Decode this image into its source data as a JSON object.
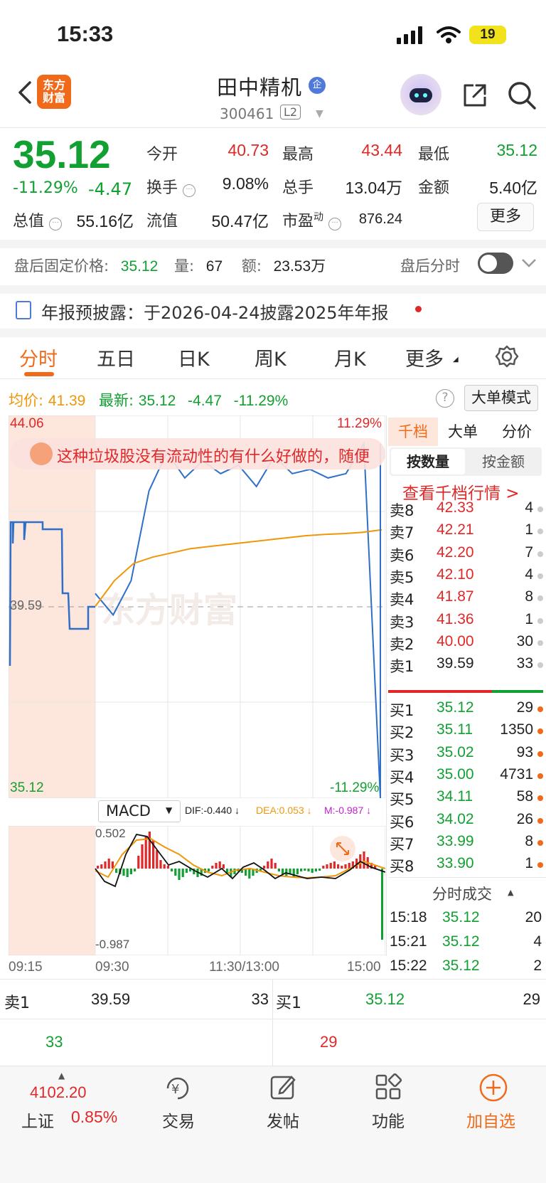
{
  "status_bar": {
    "time": "15:33",
    "battery": "19"
  },
  "header": {
    "logo_line1": "东方",
    "logo_line2": "财富",
    "stock_name": "田中精机",
    "badge": "企",
    "stock_code": "300461",
    "level": "L2"
  },
  "quote": {
    "price": "35.12",
    "change_pct": "-11.29%",
    "change_val": "-4.47",
    "open_label": "今开",
    "open": "40.73",
    "high_label": "最高",
    "high": "43.44",
    "low_label": "最低",
    "low": "35.12",
    "turnover_label": "换手",
    "turnover": "9.08%",
    "volume_label": "总手",
    "volume": "13.04万",
    "amount_label": "金额",
    "amount": "5.40亿",
    "mktcap_label": "总值",
    "mktcap": "55.16亿",
    "float_label": "流值",
    "float_cap": "50.47亿",
    "pe_label": "市盈",
    "pe_sup": "动",
    "pe": "876.24",
    "more_button": "更多"
  },
  "after_hours": {
    "price_label": "盘后固定价格:",
    "price": "35.12",
    "vol_label": "量:",
    "vol": "67",
    "amt_label": "额:",
    "amt": "23.53万",
    "chart_label": "盘后分时"
  },
  "announcement": {
    "text": "年报预披露：于2026-04-24披露2025年年报"
  },
  "tabs": [
    "分时",
    "五日",
    "日K",
    "周K",
    "月K",
    "更多"
  ],
  "chart_header": {
    "avg_label": "均价:",
    "avg": "41.39",
    "latest_label": "最新:",
    "latest": "35.12",
    "chg": "-4.47",
    "chg_pct": "-11.29%",
    "big_order_button": "大单模式"
  },
  "chart": {
    "y_top": "44.06",
    "y_mid": "39.59",
    "y_bottom": "35.12",
    "pct_top": "11.29%",
    "pct_bottom": "-11.29%",
    "watermark": "东方财富",
    "comment": "这种垃圾股没有流动性的有什么好做的，随便",
    "x_labels": [
      "09:15",
      "09:30",
      "11:30/13:00",
      "15:00"
    ]
  },
  "macd": {
    "selector": "MACD",
    "dif": "DIF:-0.440 ↓",
    "dea": "DEA:0.053 ↓",
    "m": "M:-0.987 ↓",
    "top": "0.502",
    "bottom": "-0.987"
  },
  "chart_data": {
    "type": "line",
    "title": "",
    "x_range": [
      "09:30",
      "15:00"
    ],
    "ylim": [
      35.12,
      44.06
    ],
    "reference": 39.59,
    "series": [
      {
        "values": [
          39.9,
          39.4,
          40.2,
          42.3,
          43.2,
          42.6,
          43.0,
          42.7,
          42.9,
          42.4,
          43.1,
          42.7,
          42.8,
          42.6,
          42.7,
          43.4,
          35.12
        ]
      },
      {
        "values": [
          39.6,
          40.2,
          40.6,
          40.75,
          40.85,
          40.95,
          41.0,
          41.05,
          41.1,
          41.15,
          41.2,
          41.25,
          41.28,
          41.3,
          41.33,
          41.39
        ]
      }
    ]
  },
  "order_book": {
    "tabs": [
      "千档",
      "大单",
      "分价"
    ],
    "subtabs": [
      "按数量",
      "按金额"
    ],
    "link": "查看千档行情 >",
    "asks": [
      {
        "label": "卖8",
        "price": "42.33",
        "qty": "4"
      },
      {
        "label": "卖7",
        "price": "42.21",
        "qty": "1"
      },
      {
        "label": "卖6",
        "price": "42.20",
        "qty": "7"
      },
      {
        "label": "卖5",
        "price": "42.10",
        "qty": "4"
      },
      {
        "label": "卖4",
        "price": "41.87",
        "qty": "8"
      },
      {
        "label": "卖3",
        "price": "41.36",
        "qty": "1"
      },
      {
        "label": "卖2",
        "price": "40.00",
        "qty": "30"
      },
      {
        "label": "卖1",
        "price": "39.59",
        "qty": "33"
      }
    ],
    "bids": [
      {
        "label": "买1",
        "price": "35.12",
        "qty": "29"
      },
      {
        "label": "买2",
        "price": "35.11",
        "qty": "1350"
      },
      {
        "label": "买3",
        "price": "35.02",
        "qty": "93"
      },
      {
        "label": "买4",
        "price": "35.00",
        "qty": "4731"
      },
      {
        "label": "买5",
        "price": "34.11",
        "qty": "58"
      },
      {
        "label": "买6",
        "price": "34.02",
        "qty": "26"
      },
      {
        "label": "买7",
        "price": "33.99",
        "qty": "8"
      },
      {
        "label": "买8",
        "price": "33.90",
        "qty": "1"
      }
    ],
    "ticks_title": "分时成交",
    "ticks": [
      {
        "time": "15:18",
        "price": "35.12",
        "qty": "20"
      },
      {
        "time": "15:21",
        "price": "35.12",
        "qty": "4"
      },
      {
        "time": "15:22",
        "price": "35.12",
        "qty": "2"
      }
    ]
  },
  "summary": {
    "ask_label": "卖1",
    "ask_price": "39.59",
    "ask_qty": "33",
    "ask_sub": "33",
    "bid_label": "买1",
    "bid_price": "35.12",
    "bid_qty": "29",
    "bid_sub": "29"
  },
  "bottom_bar": {
    "index_value": "4102.20",
    "index_name": "上证",
    "index_pct": "0.85%",
    "items": [
      "交易",
      "发帖",
      "功能",
      "加自选"
    ]
  }
}
